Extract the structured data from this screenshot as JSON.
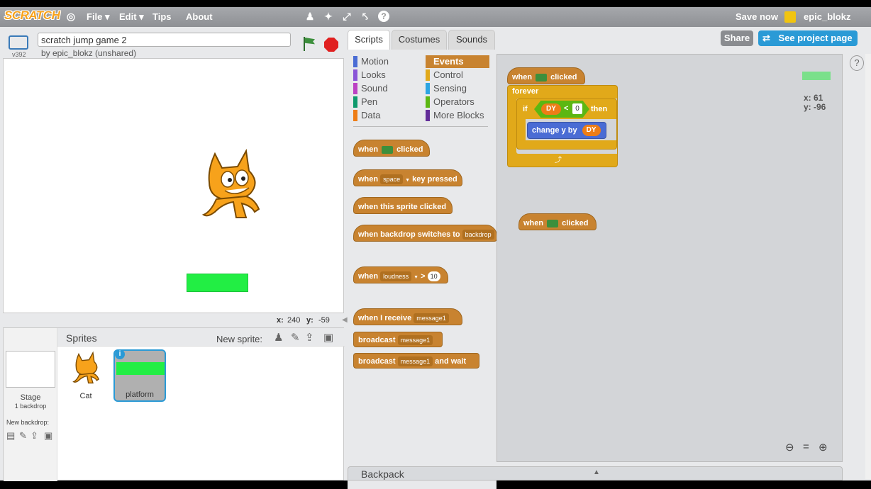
{
  "menubar": {
    "logo": "SCRATCH",
    "items": [
      "File ▾",
      "Edit ▾",
      "Tips",
      "About"
    ],
    "save_now": "Save now",
    "username": "epic_blokz"
  },
  "project": {
    "title": "scratch jump game 2",
    "byline": "by epic_blokz (unshared)",
    "version": "v392",
    "share": "Share",
    "see_project": "See project page"
  },
  "tabs": [
    "Scripts",
    "Costumes",
    "Sounds"
  ],
  "categories_left": [
    {
      "label": "Motion",
      "color": "#4a6cd4"
    },
    {
      "label": "Looks",
      "color": "#8a55d7"
    },
    {
      "label": "Sound",
      "color": "#bb42c3"
    },
    {
      "label": "Pen",
      "color": "#0e9a6c"
    },
    {
      "label": "Data",
      "color": "#ee7d16"
    }
  ],
  "categories_right": [
    {
      "label": "Events",
      "color": "#c88330",
      "selected": true
    },
    {
      "label": "Control",
      "color": "#e1a91a"
    },
    {
      "label": "Sensing",
      "color": "#2ca5e2"
    },
    {
      "label": "Operators",
      "color": "#5cb712"
    },
    {
      "label": "More Blocks",
      "color": "#632d99"
    }
  ],
  "palette": {
    "when": "when",
    "clicked": "clicked",
    "space": "space",
    "key_pressed": "key pressed",
    "this_sprite": "when this sprite clicked",
    "backdrop_switches": "when backdrop switches to",
    "backdrop": "backdrop",
    "loudness": "loudness",
    "gt": ">",
    "ten": "10",
    "i_receive": "when I receive",
    "message1": "message1",
    "broadcast": "broadcast",
    "and_wait": "and wait"
  },
  "script": {
    "forever": "forever",
    "if": "if",
    "dy": "DY",
    "lt": "<",
    "zero": "0",
    "then": "then",
    "change_y_by": "change y by"
  },
  "stage": {
    "x_label": "x:",
    "x_value": "240",
    "y_label": "y:",
    "y_value": "-59"
  },
  "sprite_readout": {
    "x": "x: 61",
    "y": "y: -96"
  },
  "sprites_pane": {
    "title": "Sprites",
    "new_sprite": "New sprite:",
    "stage_label": "Stage",
    "backdrop_count": "1 backdrop",
    "new_backdrop": "New backdrop:",
    "sprites": [
      "Cat",
      "platform"
    ]
  },
  "backpack": "Backpack",
  "colors": {
    "events": "#c88330",
    "control": "#e1a91a",
    "operators": "#5cb712",
    "motion": "#4a6cd4",
    "data": "#ee7d16",
    "platform": "#22ee44"
  }
}
